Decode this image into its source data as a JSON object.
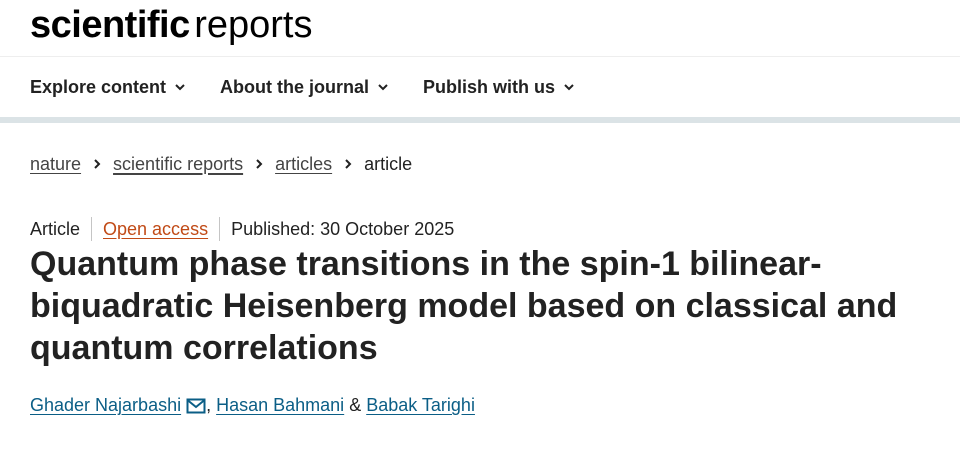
{
  "brand": {
    "bold": "scientific",
    "light": "reports"
  },
  "nav": [
    {
      "label": "Explore content"
    },
    {
      "label": "About the journal"
    },
    {
      "label": "Publish with us"
    }
  ],
  "breadcrumbs": [
    "nature",
    "scientific reports",
    "articles",
    "article"
  ],
  "article": {
    "type": "Article",
    "access": "Open access",
    "published": "Published: 30 October 2025",
    "title": "Quantum phase transitions in the spin-1 bilinear-biquadratic Heisenberg model based on classical and quantum correlations",
    "authors": [
      "Ghader Najarbashi",
      "Hasan Bahmani",
      "Babak Tarighi"
    ],
    "author_sep": ", ",
    "author_and": " & "
  },
  "colors": {
    "accent": "#c14a16",
    "link": "#0b5e86",
    "nav_rule": "#dbe3e6"
  },
  "icons": [
    "chevron-down-icon",
    "chevron-right-icon",
    "mail-icon"
  ]
}
